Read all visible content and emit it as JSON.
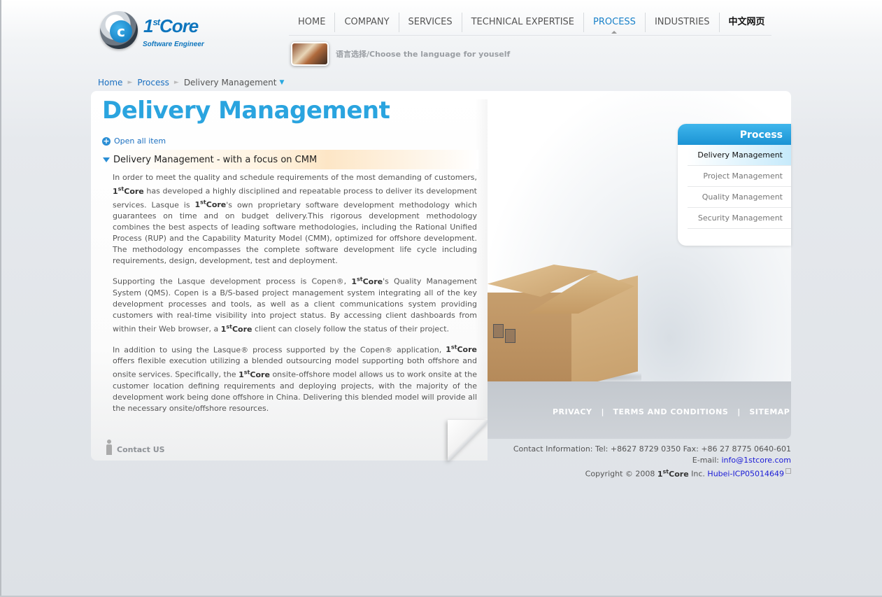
{
  "logo": {
    "mark": "c",
    "name": "1",
    "name_sup": "st",
    "name_rest": "Core",
    "tagline": "Software Engineer"
  },
  "nav": {
    "items": [
      {
        "label": "HOME"
      },
      {
        "label": "COMPANY"
      },
      {
        "label": "SERVICES"
      },
      {
        "label": "TECHNICAL EXPERTISE"
      },
      {
        "label": "PROCESS",
        "active": true
      },
      {
        "label": "INDUSTRIES"
      },
      {
        "label": "中文网页"
      }
    ]
  },
  "language": {
    "text": "语言选择/Choose the language for youself"
  },
  "breadcrumb": {
    "home": "Home",
    "process": "Process",
    "current": "Delivery Management",
    "sep": "►",
    "dropdown": "▼"
  },
  "page": {
    "title": "Delivery Management",
    "open_all": "Open all item",
    "section_title": "Delivery Management - with a focus on CMM",
    "brand_base": "1",
    "brand_sup": "st",
    "brand_rest": "Core",
    "p1_a": "In order to meet the quality and schedule requirements of the most demanding of customers, ",
    "p1_b": " has developed a highly disciplined and repeatable process to deliver its development services. Lasque is ",
    "p1_c": "'s own proprietary software development methodology which guarantees on time and on budget delivery.This rigorous development methodology combines the best aspects of leading software methodologies, including the Rational Unified Process (RUP) and the Capability Maturity Model (CMM), optimized for offshore development. The methodology encompasses the complete software development life cycle including requirements, design, development, test and deployment.",
    "p2_a": "Supporting the Lasque development process is Copen®, ",
    "p2_b": "'s Quality Management System (QMS). Copen is a B/S-based project management system integrating all of the key development processes and tools, as well as a client communications system providing customers with real-time visibility into project status. By accessing client dashboards from within their Web browser, a ",
    "p2_c": " client can closely follow the status of their project.",
    "p3_a": "In addition to using the Lasque® process supported by the Copen® application, ",
    "p3_b": " offers flexible execution utilizing a blended outsourcing model supporting both offshore and onsite services. Specifically, the ",
    "p3_c": " onsite-offshore model allows us to work onsite at the customer location defining requirements and deploying projects, with the majority of the development work being done offshore in China. Delivering this blended model will provide all the necessary onsite/offshore resources.",
    "contact_us": "Contact US"
  },
  "sidenav": {
    "title": "Process",
    "items": [
      {
        "label": "Delivery Management",
        "active": true
      },
      {
        "label": "Project Management"
      },
      {
        "label": "Quality Management"
      },
      {
        "label": "Security Management"
      }
    ]
  },
  "footer": {
    "links": [
      "PRIVACY",
      "TERMS AND CONDITIONS",
      "SITEMAP"
    ],
    "sep": "|",
    "contact": "Contact Information: Tel: +8627 8729 0350 Fax: +86 27 8775 0640-601",
    "email_label": "E-mail: ",
    "email": "info@1stcore.com",
    "copyright_a": "Copyright © 2008 ",
    "copyright_b": " Inc. ",
    "icp": "Hubei-ICP05014649"
  },
  "colors": {
    "accent": "#2aa4df",
    "link": "#1a6fc0",
    "nav_active": "#1a82c9"
  }
}
